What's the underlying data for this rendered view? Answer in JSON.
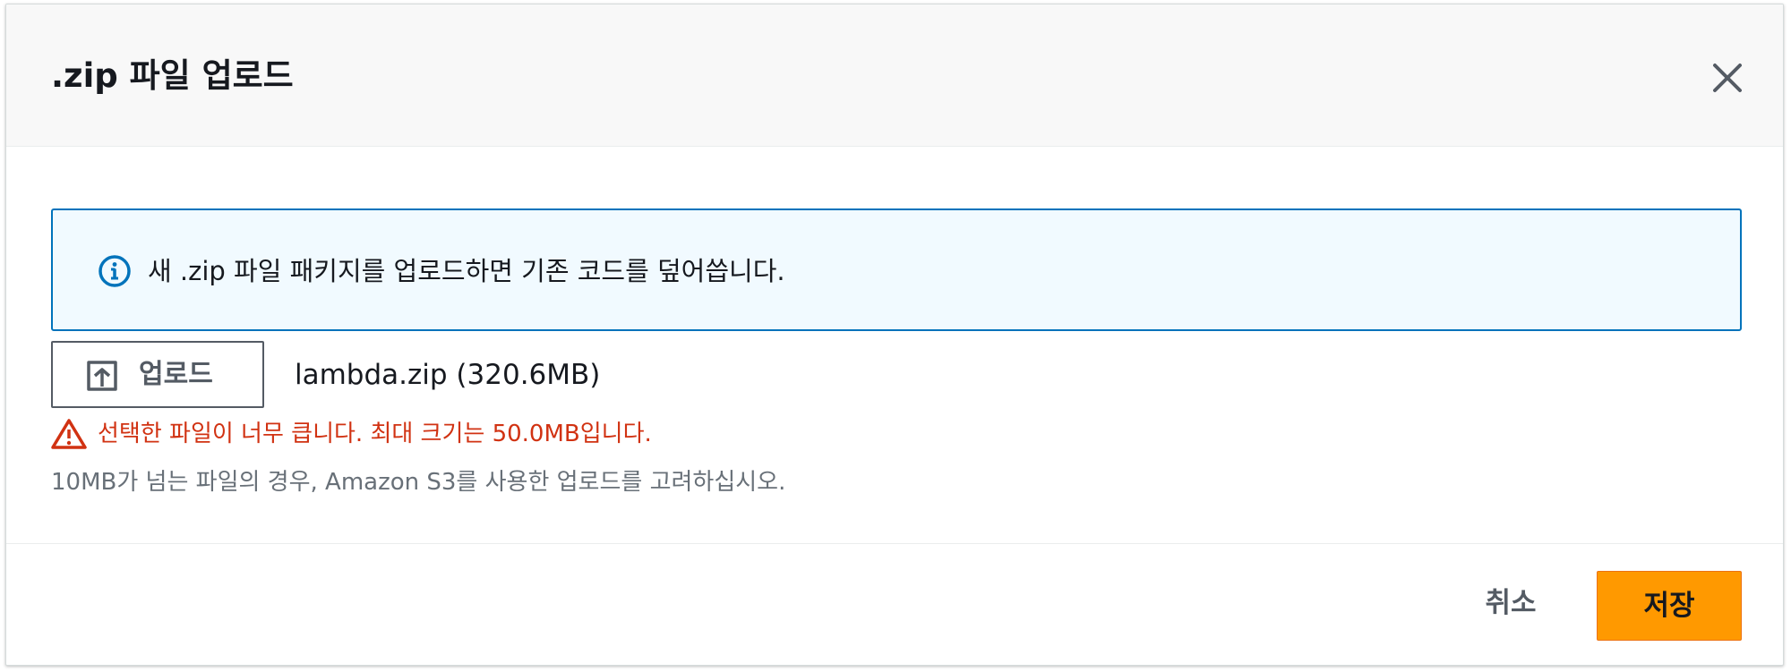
{
  "modal": {
    "title": ".zip 파일 업로드",
    "close_icon": "close-icon"
  },
  "info": {
    "icon": "info-icon",
    "message": "새 .zip 파일 패키지를 업로드하면 기존 코드를 덮어씁니다."
  },
  "upload": {
    "icon": "upload-icon",
    "button_label": "업로드",
    "file_name": "lambda.zip (320.6MB)"
  },
  "validation": {
    "icon": "warning-icon",
    "error_message": "선택한 파일이 너무 큽니다. 최대 크기는 50.0MB입니다.",
    "hint": "10MB가 넘는 파일의 경우, Amazon S3를 사용한 업로드를 고려하십시오."
  },
  "footer": {
    "cancel_label": "취소",
    "save_label": "저장"
  },
  "colors": {
    "primary_button": "#ff9900",
    "info_border": "#0073bb",
    "info_background": "#f1faff",
    "error": "#d13212",
    "hint": "#687078"
  }
}
